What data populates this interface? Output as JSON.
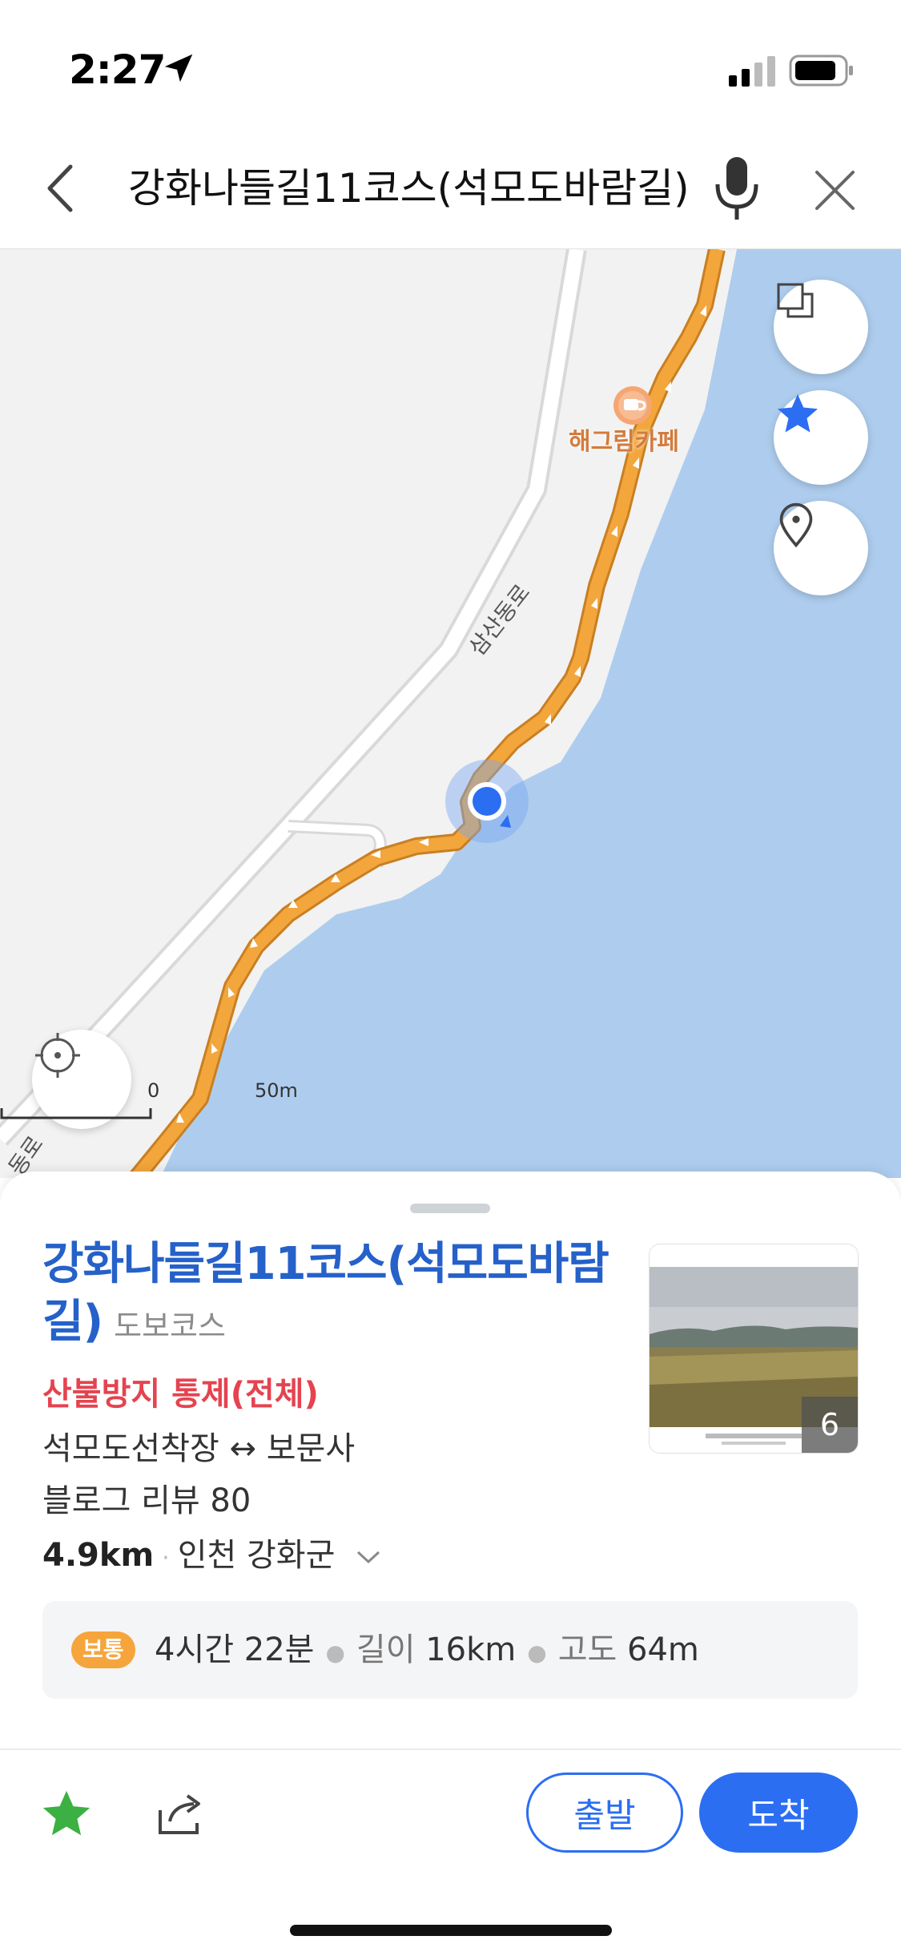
{
  "status_bar": {
    "time": "2:27"
  },
  "search": {
    "query": "강화나들길11코스(석모도바람길)"
  },
  "map": {
    "poi_label": "해그림카페",
    "road_label_main": "삼산동로",
    "road_label_corner": "동로",
    "scale_start": "0",
    "scale_end": "50m",
    "buttons": [
      "layers-icon",
      "star-icon",
      "pin-icon",
      "locate-icon"
    ]
  },
  "place": {
    "title": "강화나들길11코스(석모도바람길)",
    "category": "도보코스",
    "alert": "산불방지 통제(전체)",
    "route": "석모도선착장 ↔ 보문사",
    "blog": "블로그 리뷰 80",
    "distance": "4.9km",
    "region": "인천 강화군",
    "photo_count": "6",
    "photo_caption": "…"
  },
  "course_info": {
    "level": "보통",
    "duration": "4시간 22분",
    "length_label": "길이",
    "length": "16km",
    "altitude_label": "고도",
    "altitude": "64m"
  },
  "actions": {
    "depart": "출발",
    "arrive": "도착"
  },
  "colors": {
    "primary": "#2b6ef2",
    "route": "#f0a23a",
    "water": "#aecdee",
    "alert": "#e5434f"
  }
}
